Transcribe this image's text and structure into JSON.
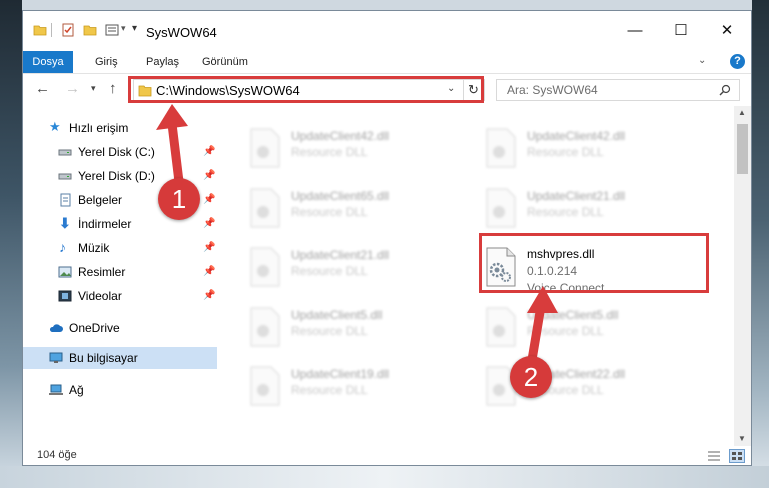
{
  "window": {
    "title": "SysWOW64",
    "controls": {
      "minimize": "—",
      "maximize": "☐",
      "close": "✕"
    }
  },
  "ribbon": {
    "tabs": [
      "Dosya",
      "Giriş",
      "Paylaş",
      "Görünüm"
    ],
    "help": "?"
  },
  "address_bar": {
    "path": "C:\\Windows\\SysWOW64",
    "search_placeholder": "Ara: SysWOW64"
  },
  "sidebar": {
    "items": [
      {
        "label": "Hızlı erişim",
        "icon": "star-icon"
      },
      {
        "label": "Yerel Disk (C:)",
        "icon": "drive-icon",
        "pinned": true
      },
      {
        "label": "Yerel Disk (D:)",
        "icon": "drive-icon",
        "pinned": true
      },
      {
        "label": "Belgeler",
        "icon": "documents-icon",
        "pinned": true
      },
      {
        "label": "İndirmeler",
        "icon": "download-icon",
        "pinned": true
      },
      {
        "label": "Müzik",
        "icon": "music-icon",
        "pinned": true
      },
      {
        "label": "Resimler",
        "icon": "pictures-icon",
        "pinned": true
      },
      {
        "label": "Videolar",
        "icon": "videos-icon",
        "pinned": true
      },
      {
        "label": "OneDrive",
        "icon": "cloud-icon"
      },
      {
        "label": "Bu bilgisayar",
        "icon": "computer-icon",
        "selected": true
      },
      {
        "label": "Ağ",
        "icon": "network-icon"
      }
    ]
  },
  "files": [
    {
      "name": "UpdateClient42.dll",
      "type": "Resource DLL"
    },
    {
      "name": "UpdateClient42.dll",
      "type": "Resource DLL"
    },
    {
      "name": "UpdateClient65.dll",
      "type": "Resource DLL"
    },
    {
      "name": "UpdateClient21.dll",
      "type": "Resource DLL"
    },
    {
      "name": "UpdateClient21.dll",
      "type": "Resource DLL"
    },
    {
      "name": "mshvpres.dll",
      "version": "0.1.0.214",
      "description": "Voice Connect",
      "highlighted": true
    },
    {
      "name": "UpdateClient5.dll",
      "type": "Resource DLL"
    },
    {
      "name": "UpdateClient5.dll",
      "type": "Resource DLL"
    },
    {
      "name": "UpdateClient19.dll",
      "type": "Resource DLL"
    },
    {
      "name": "UpdateClient22.dll",
      "type": "Resource DLL"
    }
  ],
  "status_bar": {
    "item_count": "104 öğe"
  },
  "annotations": {
    "step1": "1",
    "step2": "2",
    "color": "#d83c3c"
  }
}
